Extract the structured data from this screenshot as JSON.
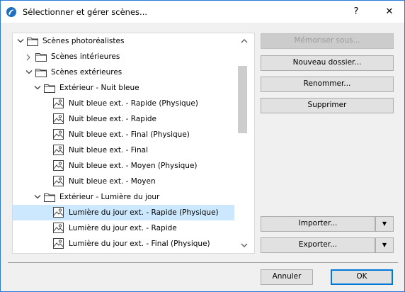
{
  "window": {
    "title": "Sélectionner et gérer scènes...",
    "help_label": "?",
    "close_label": "✕"
  },
  "tree": {
    "rows": [
      {
        "label": "Scènes photoréalistes"
      },
      {
        "label": "Scènes intérieures"
      },
      {
        "label": "Scènes extérieures"
      },
      {
        "label": "Extérieur - Nuit bleue"
      },
      {
        "label": "Nuit bleue ext. - Rapide (Physique)"
      },
      {
        "label": "Nuit bleue ext. - Rapide"
      },
      {
        "label": "Nuit bleue ext. - Final (Physique)"
      },
      {
        "label": "Nuit bleue ext. - Final"
      },
      {
        "label": "Nuit bleue ext. - Moyen (Physique)"
      },
      {
        "label": "Nuit bleue ext. - Moyen"
      },
      {
        "label": "Extérieur - Lumière du jour"
      },
      {
        "label": "Lumière du jour ext. - Rapide (Physique)"
      },
      {
        "label": "Lumière du jour ext. - Rapide"
      },
      {
        "label": "Lumière du jour ext. - Final (Physique)"
      }
    ]
  },
  "actions": {
    "memorize": "Mémoriser sous...",
    "new_folder": "Nouveau dossier...",
    "rename": "Renommer...",
    "delete": "Supprimer",
    "import": "Importer...",
    "export": "Exporter..."
  },
  "footer": {
    "cancel": "Annuler",
    "ok": "OK"
  },
  "colors": {
    "selection": "#cce8ff",
    "accent": "#0078d7",
    "window_border": "#2b79d6"
  }
}
